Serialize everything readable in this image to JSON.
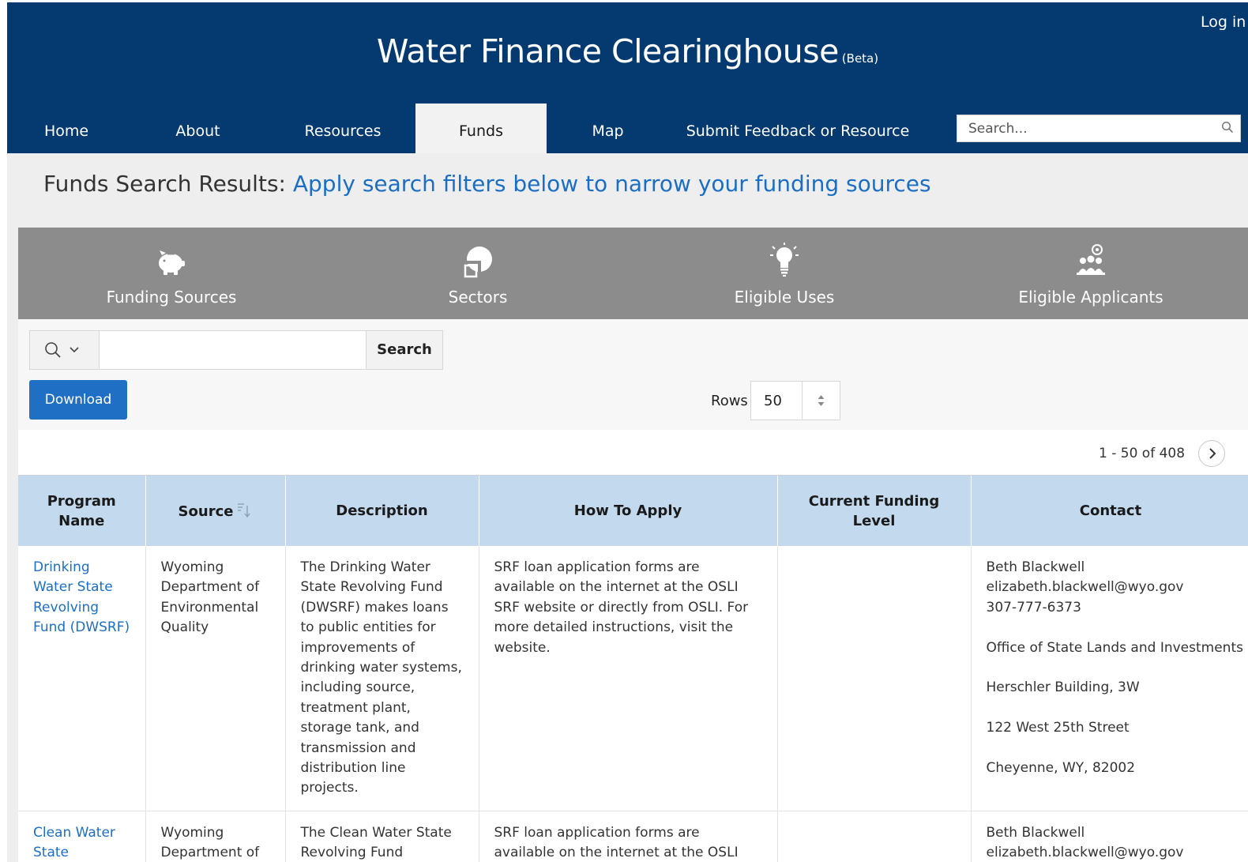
{
  "header": {
    "title": "Water Finance Clearinghouse",
    "beta": "(Beta)",
    "login": "Log in"
  },
  "nav": {
    "items": [
      {
        "label": "Home"
      },
      {
        "label": "About"
      },
      {
        "label": "Resources"
      },
      {
        "label": "Funds",
        "active": true
      },
      {
        "label": "Map"
      },
      {
        "label": "Submit Feedback or Resource"
      }
    ],
    "search_placeholder": "Search..."
  },
  "page": {
    "heading_prefix": "Funds Search Results:",
    "heading_accent": "Apply search filters below to narrow your funding sources"
  },
  "filters": [
    {
      "label": "Funding Sources",
      "icon": "piggy-bank-icon"
    },
    {
      "label": "Sectors",
      "icon": "sectors-icon"
    },
    {
      "label": "Eligible Uses",
      "icon": "lightbulb-icon"
    },
    {
      "label": "Eligible Applicants",
      "icon": "people-icon"
    }
  ],
  "toolbar": {
    "search_button": "Search",
    "download_button": "Download",
    "rows_label": "Rows",
    "rows_value": "50"
  },
  "pagination": {
    "range": "1 - 50 of 408"
  },
  "table": {
    "columns": [
      "Program Name",
      "Source",
      "Description",
      "How To Apply",
      "Current Funding Level",
      "Contact"
    ],
    "rows": [
      {
        "program": "Drinking Water State Revolving Fund (DWSRF)",
        "source": "Wyoming Department of Environmental Quality",
        "description": "The Drinking Water State Revolving Fund (DWSRF) makes loans to public entities for improvements of drinking water systems, including source, treatment plant, storage tank, and transmission and distribution line projects.",
        "how_to_apply": "SRF loan application forms are available on the internet at the OSLI SRF website or directly from OSLI. For more detailed instructions, visit the website.",
        "funding_level": "",
        "contact": {
          "name": "Beth Blackwell",
          "email": "elizabeth.blackwell@wyo.gov",
          "phone": "307-777-6373",
          "office": "Office of State Lands and Investments",
          "building": "Herschler Building, 3W",
          "street": "122 West 25th Street",
          "city": "Cheyenne, WY, 82002"
        }
      },
      {
        "program": "Clean Water State",
        "source": "Wyoming Department of",
        "description": "The Clean Water State Revolving Fund",
        "how_to_apply": "SRF loan application forms are available on the internet at the OSLI SRF website",
        "funding_level": "",
        "contact": {
          "name": "Beth Blackwell",
          "email": "elizabeth.blackwell@wyo.gov"
        }
      }
    ]
  },
  "colors": {
    "header_bg": "#053a70",
    "accent_link": "#1c6ec2",
    "download_btn": "#1f6fc5",
    "filter_bar": "#8c8c8c",
    "table_header": "#c3d9ee"
  }
}
